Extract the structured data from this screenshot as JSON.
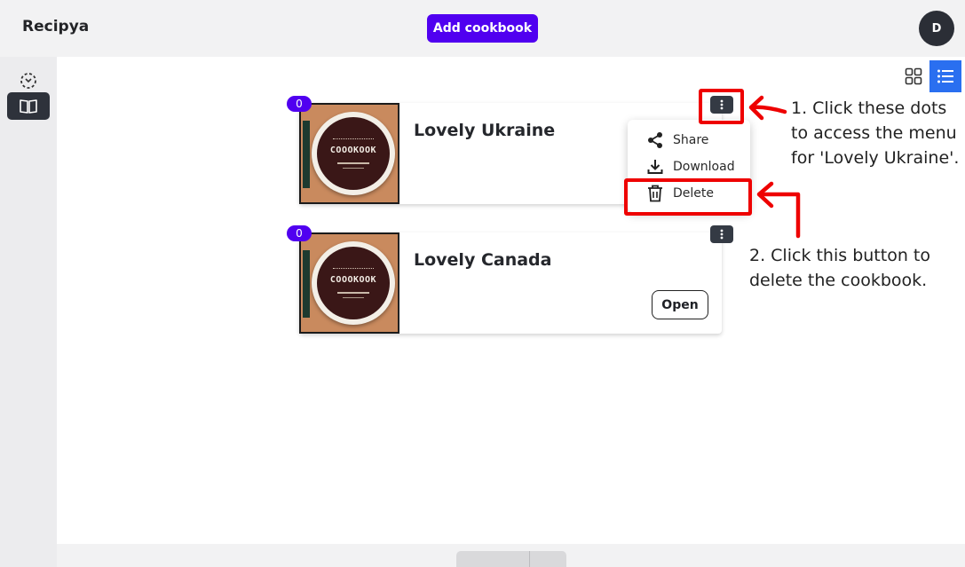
{
  "app": {
    "brand": "Recipya",
    "avatar_initial": "D"
  },
  "header": {
    "add_cookbook_label": "Add cookbook"
  },
  "cookbooks": [
    {
      "title": "Lovely Ukraine",
      "count": "0",
      "cover_label": "COOOKOOK"
    },
    {
      "title": "Lovely Canada",
      "count": "0",
      "cover_label": "COOOKOOK",
      "open_label": "Open"
    }
  ],
  "menu": {
    "items": [
      {
        "label": "Share",
        "icon": "share-icon"
      },
      {
        "label": "Download",
        "icon": "download-icon"
      },
      {
        "label": "Delete",
        "icon": "trash-icon"
      }
    ]
  },
  "annotations": {
    "step1": "1. Click these dots\nto access the menu\nfor 'Lovely Ukraine'.",
    "step2": "2. Click this button to\ndelete the cookbook."
  },
  "colors": {
    "accent": "#5000f0",
    "highlight": "#ee0000",
    "view_active": "#2a6ff0"
  }
}
